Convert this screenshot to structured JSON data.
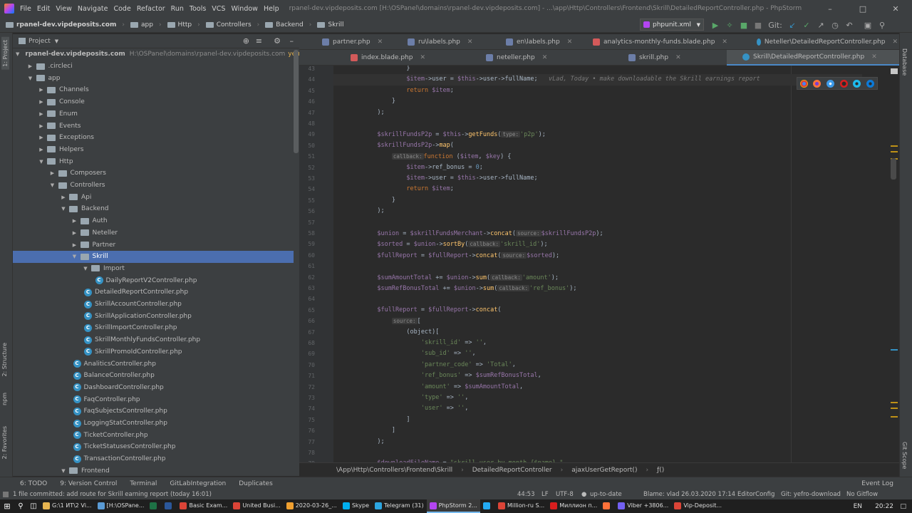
{
  "window": {
    "title": "rpanel-dev.vipdeposits.com [H:\\OSPanel\\domains\\rpanel-dev.vipdeposits.com] - ...\\app\\Http\\Controllers\\Frontend\\Skrill\\DetailedReportController.php - PhpStorm"
  },
  "menu": [
    "File",
    "Edit",
    "View",
    "Navigate",
    "Code",
    "Refactor",
    "Run",
    "Tools",
    "VCS",
    "Window",
    "Help"
  ],
  "breadcrumbs": [
    "rpanel-dev.vipdeposits.com",
    "app",
    "Http",
    "Controllers",
    "Backend",
    "Skrill"
  ],
  "toolbar": {
    "run_config": "phpunit.xml",
    "git_label": "Git:"
  },
  "project_panel": {
    "title": "Project"
  },
  "side_tabs": {
    "project": "1: Project",
    "structure": "2: Structure",
    "npm": "npm",
    "favorites": "2: Favorites",
    "database": "Database",
    "gitscope": "Git Scope"
  },
  "tree": [
    {
      "label": "rpanel-dev.vipdeposits.com",
      "hint": "H:\\OSPanel\\domains\\rpanel-dev.vipdeposits.com",
      "branch": "yefro-",
      "depth": 0,
      "type": "folder",
      "open": true,
      "bold": true
    },
    {
      "label": ".circleci",
      "depth": 1,
      "type": "folder",
      "open": false
    },
    {
      "label": "app",
      "depth": 1,
      "type": "folder",
      "open": true
    },
    {
      "label": "Channels",
      "depth": 2,
      "type": "folder",
      "open": false
    },
    {
      "label": "Console",
      "depth": 2,
      "type": "folder",
      "open": false
    },
    {
      "label": "Enum",
      "depth": 2,
      "type": "folder",
      "open": false
    },
    {
      "label": "Events",
      "depth": 2,
      "type": "folder",
      "open": false
    },
    {
      "label": "Exceptions",
      "depth": 2,
      "type": "folder",
      "open": false
    },
    {
      "label": "Helpers",
      "depth": 2,
      "type": "folder",
      "open": false
    },
    {
      "label": "Http",
      "depth": 2,
      "type": "folder",
      "open": true
    },
    {
      "label": "Composers",
      "depth": 3,
      "type": "folder",
      "open": false
    },
    {
      "label": "Controllers",
      "depth": 3,
      "type": "folder",
      "open": true
    },
    {
      "label": "Api",
      "depth": 4,
      "type": "folder",
      "open": false
    },
    {
      "label": "Backend",
      "depth": 4,
      "type": "folder",
      "open": true
    },
    {
      "label": "Auth",
      "depth": 5,
      "type": "folder",
      "open": false
    },
    {
      "label": "Neteller",
      "depth": 5,
      "type": "folder",
      "open": false
    },
    {
      "label": "Partner",
      "depth": 5,
      "type": "folder",
      "open": false
    },
    {
      "label": "Skrill",
      "depth": 5,
      "type": "folder",
      "open": true,
      "selected": true
    },
    {
      "label": "Import",
      "depth": 6,
      "type": "folder",
      "open": true
    },
    {
      "label": "DailyReportV2Controller.php",
      "depth": 7,
      "type": "class"
    },
    {
      "label": "DetailedReportController.php",
      "depth": 6,
      "type": "class"
    },
    {
      "label": "SkrillAccountController.php",
      "depth": 6,
      "type": "class"
    },
    {
      "label": "SkrillApplicationController.php",
      "depth": 6,
      "type": "class"
    },
    {
      "label": "SkrillImportController.php",
      "depth": 6,
      "type": "class"
    },
    {
      "label": "SkrillMonthlyFundsController.php",
      "depth": 6,
      "type": "class"
    },
    {
      "label": "SkrillPromoIdController.php",
      "depth": 6,
      "type": "class"
    },
    {
      "label": "AnaliticsController.php",
      "depth": 5,
      "type": "class"
    },
    {
      "label": "BalanceController.php",
      "depth": 5,
      "type": "class"
    },
    {
      "label": "DashboardController.php",
      "depth": 5,
      "type": "class"
    },
    {
      "label": "FaqController.php",
      "depth": 5,
      "type": "class"
    },
    {
      "label": "FaqSubjectsController.php",
      "depth": 5,
      "type": "class"
    },
    {
      "label": "LoggingStatController.php",
      "depth": 5,
      "type": "class"
    },
    {
      "label": "TicketController.php",
      "depth": 5,
      "type": "class"
    },
    {
      "label": "TicketStatusesController.php",
      "depth": 5,
      "type": "class"
    },
    {
      "label": "TransactionController.php",
      "depth": 5,
      "type": "class"
    },
    {
      "label": "Frontend",
      "depth": 4,
      "type": "folder",
      "open": true
    }
  ],
  "tabs_row1": [
    {
      "label": "partner.php",
      "kind": "php"
    },
    {
      "label": "ru\\labels.php",
      "kind": "php"
    },
    {
      "label": "en\\labels.php",
      "kind": "php"
    },
    {
      "label": "analytics-monthly-funds.blade.php",
      "kind": "blade"
    },
    {
      "label": "Neteller\\DetailedReportController.php",
      "kind": "class"
    }
  ],
  "tabs_row2": [
    {
      "label": "index.blade.php",
      "kind": "blade"
    },
    {
      "label": "neteller.php",
      "kind": "php"
    },
    {
      "label": "skrill.php",
      "kind": "php"
    },
    {
      "label": "Skrill\\DetailedReportController.php",
      "kind": "class",
      "active": true
    }
  ],
  "code_lines": [
    {
      "n": "43",
      "t": "                    }"
    },
    {
      "n": "44",
      "t": "                    $item->user = $this->user->fullName;",
      "blame": "vLad, Today • make downloadable the Skrill earnings report",
      "current": true
    },
    {
      "n": "45",
      "t": "                    return $item;"
    },
    {
      "n": "46",
      "t": "                }"
    },
    {
      "n": "47",
      "t": "            );"
    },
    {
      "n": "48",
      "t": ""
    },
    {
      "n": "49",
      "t": "            $skrillFundsP2p = $this->getFunds(",
      "hint": "type:",
      "t2": "'p2p');"
    },
    {
      "n": "50",
      "t": "            $skrillFundsP2p->map("
    },
    {
      "n": "51",
      "t": "                ",
      "hint": "callback:",
      "t2": "function ($item, $key) {"
    },
    {
      "n": "52",
      "t": "                    $item->ref_bonus = 0;"
    },
    {
      "n": "53",
      "t": "                    $item->user = $this->user->fullName;"
    },
    {
      "n": "54",
      "t": "                    return $item;"
    },
    {
      "n": "55",
      "t": "                }"
    },
    {
      "n": "56",
      "t": "            );"
    },
    {
      "n": "57",
      "t": ""
    },
    {
      "n": "58",
      "t": "            $union = $skrillFundsMerchant->concat(",
      "hint": "source:",
      "t2": "$skrillFundsP2p);"
    },
    {
      "n": "59",
      "t": "            $sorted = $union->sortBy(",
      "hint": "callback:",
      "t2": "'skrill_id');"
    },
    {
      "n": "60",
      "t": "            $fullReport = $fullReport->concat(",
      "hint": "source:",
      "t2": "$sorted);"
    },
    {
      "n": "61",
      "t": ""
    },
    {
      "n": "62",
      "t": "            $sumAmountTotal += $union->sum(",
      "hint": "callback:",
      "t2": "'amount');"
    },
    {
      "n": "63",
      "t": "            $sumRefBonusTotal += $union->sum(",
      "hint": "callback:",
      "t2": "'ref_bonus');"
    },
    {
      "n": "64",
      "t": ""
    },
    {
      "n": "65",
      "t": "            $fullReport = $fullReport->concat("
    },
    {
      "n": "66",
      "t": "                ",
      "hint": "source:",
      "t2": "["
    },
    {
      "n": "67",
      "t": "                    (object)["
    },
    {
      "n": "68",
      "t": "                        'skrill_id' => '',"
    },
    {
      "n": "69",
      "t": "                        'sub_id' => '',"
    },
    {
      "n": "70",
      "t": "                        'partner_code' => 'Total',"
    },
    {
      "n": "71",
      "t": "                        'ref_bonus' => $sumRefBonusTotal,"
    },
    {
      "n": "72",
      "t": "                        'amount' => $sumAmountTotal,"
    },
    {
      "n": "73",
      "t": "                        'type' => '',"
    },
    {
      "n": "74",
      "t": "                        'user' => '',"
    },
    {
      "n": "75",
      "t": "                    ]"
    },
    {
      "n": "76",
      "t": "                ]"
    },
    {
      "n": "77",
      "t": "            );"
    },
    {
      "n": "78",
      "t": ""
    },
    {
      "n": "79",
      "t": "            $downloadFileName = \"skrill_user_by_month_{$name}_\""
    }
  ],
  "editor_breadcrumb": [
    "\\App\\Http\\Controllers\\Frontend\\Skrill",
    "DetailedReportController",
    "ajaxUserGetReport()",
    "ƒ()"
  ],
  "tool_windows": [
    "6: TODO",
    "9: Version Control",
    "Terminal",
    "GitLabIntegration",
    "Duplicates"
  ],
  "event_log": "Event Log",
  "status": {
    "message": "1 file committed: add route for Skrill earning report (today 16:01)",
    "position": "44:53",
    "line_sep": "LF",
    "encoding": "UTF-8",
    "vcs": "up-to-date",
    "blame": "Blame: vlad 26.03.2020 17:14",
    "editorconfig": "EditorConfig",
    "git": "Git: yefro-download",
    "gitflow": "No Gitflow"
  },
  "taskbar": {
    "items": [
      {
        "label": "G:\\1 ИТ\\2 Vi...",
        "color": "#e6b450"
      },
      {
        "label": "[H:\\OSPane...",
        "color": "#5a9bd5"
      },
      {
        "label": "",
        "color": "#1e7145"
      },
      {
        "label": "",
        "color": "#2b579a"
      },
      {
        "label": "Basic Exam...",
        "color": "#db4437"
      },
      {
        "label": "United Busi...",
        "color": "#db4437"
      },
      {
        "label": "2020-03-26_...",
        "color": "#f0a030"
      },
      {
        "label": "Skype",
        "color": "#00aff0"
      },
      {
        "label": "Telegram (31)",
        "color": "#2ca5e0"
      },
      {
        "label": "PhpStorm 2...",
        "color": "#b345f1",
        "active": true
      },
      {
        "label": "",
        "color": "#23a9f2"
      },
      {
        "label": "Million-ru S...",
        "color": "#db4437"
      },
      {
        "label": "Миллион п...",
        "color": "#d81e1e"
      },
      {
        "label": "",
        "color": "#ff7139"
      },
      {
        "label": "Viber +3806...",
        "color": "#7360f2"
      },
      {
        "label": "Vip-Deposit...",
        "color": "#db4437"
      }
    ],
    "lang": "EN",
    "time": "20:22"
  }
}
